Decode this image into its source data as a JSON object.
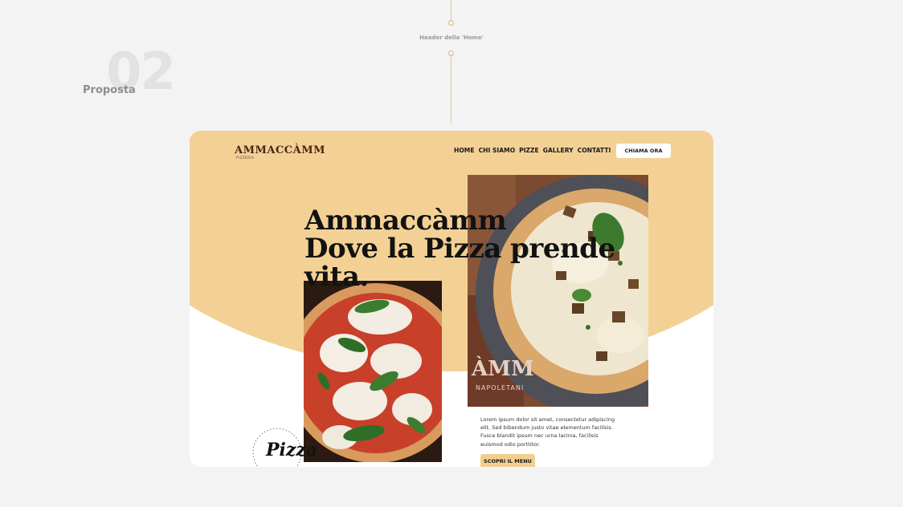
{
  "presentation": {
    "number": "02",
    "label": "Proposta",
    "caption": "Header della 'Home'"
  },
  "site": {
    "logo": "AMMACCÀMM",
    "logo_sub": "PIZZERIA",
    "nav": [
      {
        "key": "home",
        "label": "HOME"
      },
      {
        "key": "chi-siamo",
        "label": "CHI SIAMO"
      },
      {
        "key": "pizze",
        "label": "PIZZE"
      },
      {
        "key": "gallery",
        "label": "GALLERY"
      },
      {
        "key": "contatti",
        "label": "CONTATTI"
      }
    ],
    "cta_label": "CHIAMA ORA"
  },
  "hero": {
    "headline_lines": [
      "Ammaccàmm",
      "Dove la Pizza prende",
      "vita."
    ],
    "paragraph": "Lorem ipsum dolor sit amet, consectetur adipiscing elit. Sed bibendum justo vitae elementum facilisis. Fusce blandit ipsum nec urna lacinia, facilisis euismod odio porttitor.",
    "menu_button": "SCOPRI IL MENU",
    "badge_script": "Pizza"
  },
  "colors": {
    "cream": "#f3d195",
    "button": "#f3cf8e",
    "logo": "#4a2516",
    "background": "#f3f3f3"
  }
}
